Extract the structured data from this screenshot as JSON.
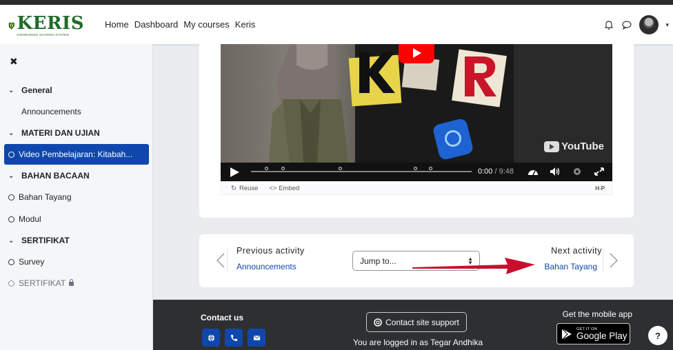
{
  "logo": {
    "word": "KERIS",
    "subtitle": "KNOWLEDGE SHARING SYSTEM"
  },
  "navbar": {
    "links": [
      "Home",
      "Dashboard",
      "My courses",
      "Keris"
    ],
    "icons": [
      "bell-icon",
      "chat-icon",
      "avatar",
      "chevron-down-icon"
    ]
  },
  "sidebar": {
    "close_icon": "close-icon",
    "items": [
      {
        "label": "General",
        "kind": "section"
      },
      {
        "label": "Announcements",
        "kind": "plain"
      },
      {
        "label": "MATERI DAN UJIAN",
        "kind": "section"
      },
      {
        "label": "Video Pembelajaran: Kitabah...",
        "kind": "activity",
        "active": true
      },
      {
        "label": "BAHAN BACAAN",
        "kind": "section"
      },
      {
        "label": "Bahan Tayang",
        "kind": "activity"
      },
      {
        "label": "Modul",
        "kind": "activity"
      },
      {
        "label": "SERTIFIKAT",
        "kind": "section"
      },
      {
        "label": "Survey",
        "kind": "activity"
      },
      {
        "label": "SERTIFIKAT",
        "kind": "activity",
        "locked": true
      }
    ]
  },
  "video": {
    "youtube_label": "YouTube",
    "current_time": "0:00",
    "duration": "9:48",
    "progress": 0,
    "reuse_label": "Reuse",
    "embed_label": "Embed",
    "h5p_label": "H-P"
  },
  "activity_nav": {
    "previous_label": "Previous activity",
    "previous_link": "Announcements",
    "jump_placeholder": "Jump to...",
    "next_label": "Next activity",
    "next_link": "Bahan Tayang"
  },
  "footer": {
    "contact_us": "Contact us",
    "support_button": "Contact site support",
    "logged_in": "You are logged in as Tegar Andhika",
    "mobile_app": "Get the mobile app",
    "gplay_small": "GET IT ON",
    "gplay_big": "Google Play",
    "help": "?"
  },
  "colors": {
    "primary": "#0f47ad",
    "footer_bg": "#2e2f31",
    "annotation_arrow": "#c8102e",
    "logo_green": "#1f6b2b"
  }
}
